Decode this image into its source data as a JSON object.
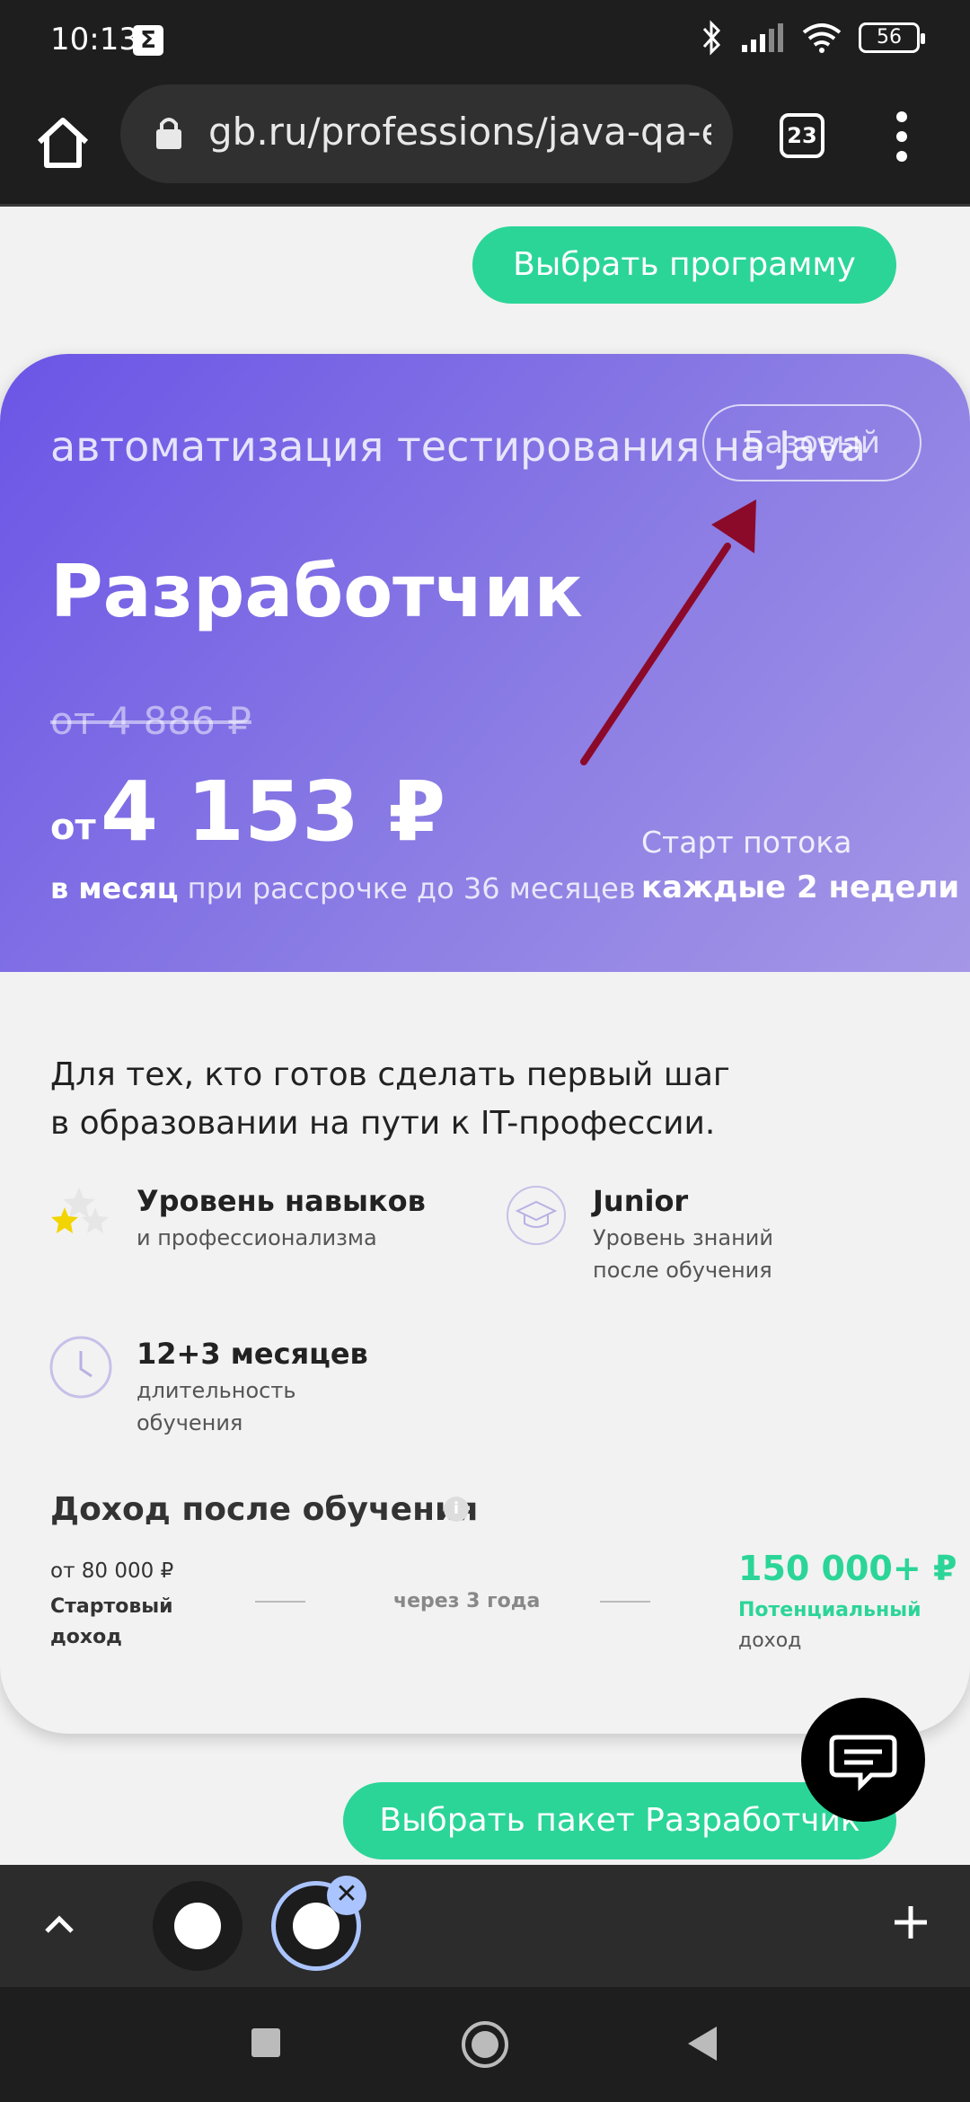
{
  "status_bar": {
    "time": "10:13",
    "sigma": "Σ",
    "battery": "56"
  },
  "browser": {
    "url": "gb.ru/professions/java-qa-en",
    "tab_count": "23"
  },
  "choose_program_label": "Выбрать программу",
  "hero": {
    "subtitle": "автоматизация тестирования на Java",
    "badge": "Базовый",
    "title": "Разработчик",
    "old_price": "от 4 886 ₽",
    "price_from": "от",
    "price": "4 153 ₽",
    "installment_bold": "в месяц",
    "installment_rest": " при рассрочке до 36 месяцев",
    "start_label": "Старт потока",
    "start_value": "каждые 2 недели"
  },
  "description": [
    "Для тех, кто готов сделать первый шаг",
    "в образовании на пути к IT-профессии."
  ],
  "features": {
    "skill": {
      "title": "Уровень навыков",
      "sub": "и профессионализма"
    },
    "level": {
      "title": "Junior",
      "sub1": "Уровень знаний",
      "sub2": "после обучения"
    },
    "duration": {
      "title": "12+3 месяцев",
      "sub1": "длительность",
      "sub2": "обучения"
    }
  },
  "income": {
    "title": "Доход после обучения",
    "info": "i",
    "start_value": "от 80 000 ₽",
    "start_label1": "Стартовый",
    "start_label2": "доход",
    "middle": "через 3 года",
    "potential_value": "150 000+ ₽",
    "potential_label": "Потенциальный",
    "potential_sub": "доход"
  },
  "package_button_label": "Выбрать пакет Разработчик",
  "tab_close": "✕",
  "colors": {
    "accent_green": "#2bd598",
    "hero_purple": "#6b55e6",
    "annotation_arrow": "#8b0a2a"
  }
}
